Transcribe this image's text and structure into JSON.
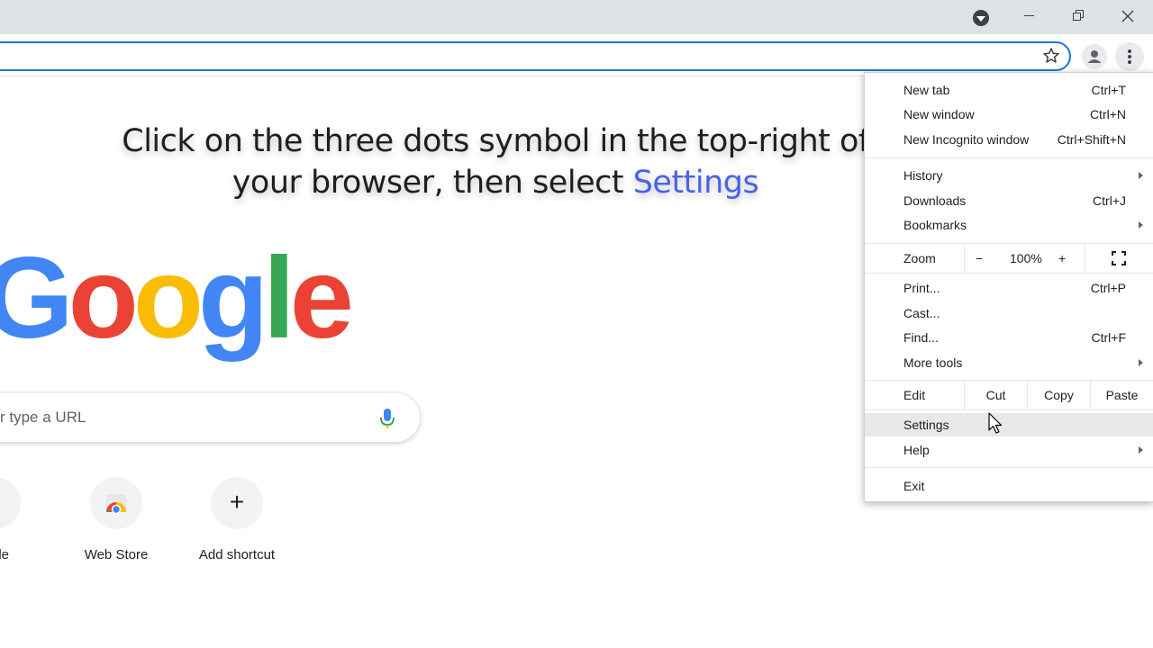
{
  "page": {
    "instruction_line1": "Click on the three dots symbol in the top-right of",
    "instruction_line2_prefix": "your browser, then select ",
    "instruction_line2_highlight": "Settings",
    "logo_letters": [
      "G",
      "o",
      "o",
      "g",
      "l",
      "e"
    ],
    "search_placeholder": "r type a URL",
    "shortcuts": [
      {
        "label": "gle",
        "icon": "google-g-icon"
      },
      {
        "label": "Web Store",
        "icon": "chrome-web-store-icon"
      },
      {
        "label": "Add shortcut",
        "icon": "plus-icon"
      }
    ],
    "add_symbol": "+"
  },
  "colors": {
    "google_blue": "#4285f4",
    "google_red": "#ea4335",
    "google_yellow": "#fbbc05",
    "google_green": "#34a853",
    "highlight": "#4b62e6",
    "omnibox_border": "#1a73e8"
  },
  "menu": {
    "new_tab": {
      "label": "New tab",
      "shortcut": "Ctrl+T"
    },
    "new_window": {
      "label": "New window",
      "shortcut": "Ctrl+N"
    },
    "incognito": {
      "label": "New Incognito window",
      "shortcut": "Ctrl+Shift+N"
    },
    "history": {
      "label": "History"
    },
    "downloads": {
      "label": "Downloads",
      "shortcut": "Ctrl+J"
    },
    "bookmarks": {
      "label": "Bookmarks"
    },
    "zoom": {
      "label": "Zoom",
      "minus": "−",
      "value": "100%",
      "plus": "+"
    },
    "print": {
      "label": "Print...",
      "shortcut": "Ctrl+P"
    },
    "cast": {
      "label": "Cast..."
    },
    "find": {
      "label": "Find...",
      "shortcut": "Ctrl+F"
    },
    "more_tools": {
      "label": "More tools"
    },
    "edit": {
      "label": "Edit",
      "cut": "Cut",
      "copy": "Copy",
      "paste": "Paste"
    },
    "settings": {
      "label": "Settings"
    },
    "help": {
      "label": "Help"
    },
    "exit": {
      "label": "Exit"
    }
  }
}
